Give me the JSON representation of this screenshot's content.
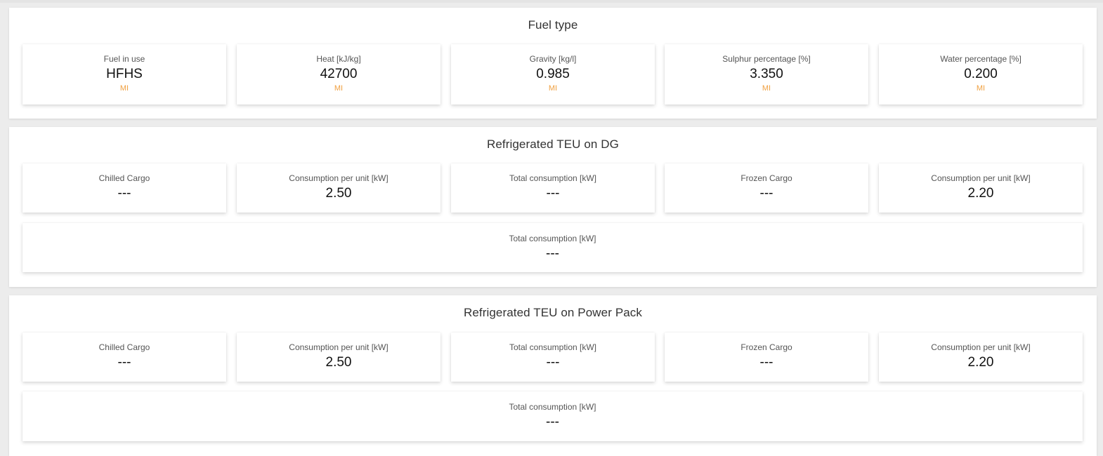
{
  "colors": {
    "background": "#ececec",
    "panel": "#ffffff",
    "source_accent": "#f0a040"
  },
  "fuel_type": {
    "title": "Fuel type",
    "cards": [
      {
        "label": "Fuel in use",
        "value": "HFHS",
        "source": "MI"
      },
      {
        "label": "Heat [kJ/kg]",
        "value": "42700",
        "source": "MI"
      },
      {
        "label": "Gravity [kg/l]",
        "value": "0.985",
        "source": "MI"
      },
      {
        "label": "Sulphur percentage [%]",
        "value": "3.350",
        "source": "MI"
      },
      {
        "label": "Water percentage [%]",
        "value": "0.200",
        "source": "MI"
      }
    ]
  },
  "teu_dg": {
    "title": "Refrigerated TEU on DG",
    "cards": [
      {
        "label": "Chilled Cargo",
        "value": "---"
      },
      {
        "label": "Consumption per unit [kW]",
        "value": "2.50"
      },
      {
        "label": "Total consumption [kW]",
        "value": "---"
      },
      {
        "label": "Frozen Cargo",
        "value": "---"
      },
      {
        "label": "Consumption per unit [kW]",
        "value": "2.20"
      }
    ],
    "total": {
      "label": "Total consumption [kW]",
      "value": "---"
    }
  },
  "teu_power_pack": {
    "title": "Refrigerated TEU on Power Pack",
    "cards": [
      {
        "label": "Chilled Cargo",
        "value": "---"
      },
      {
        "label": "Consumption per unit [kW]",
        "value": "2.50"
      },
      {
        "label": "Total consumption [kW]",
        "value": "---"
      },
      {
        "label": "Frozen Cargo",
        "value": "---"
      },
      {
        "label": "Consumption per unit [kW]",
        "value": "2.20"
      }
    ],
    "total": {
      "label": "Total consumption [kW]",
      "value": "---"
    }
  }
}
